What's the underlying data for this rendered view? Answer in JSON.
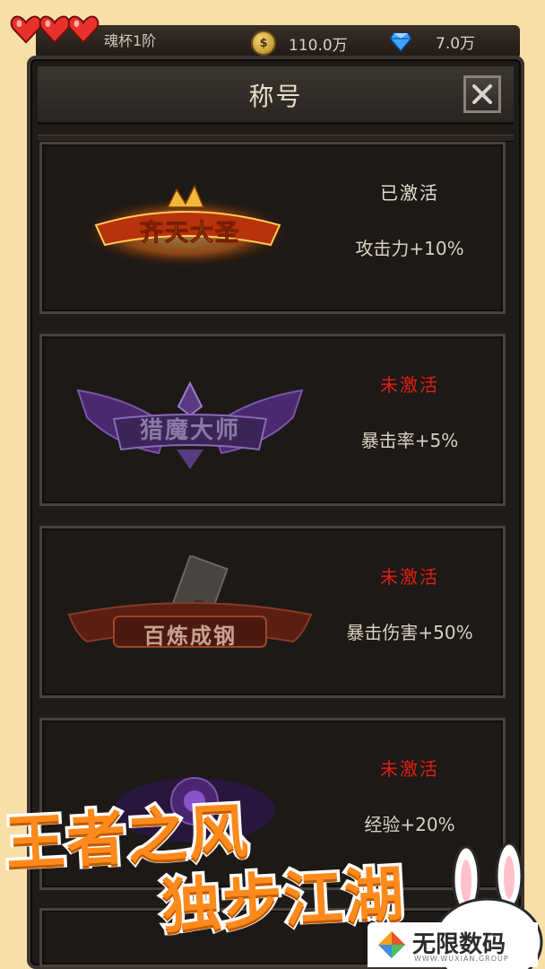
{
  "topbar": {
    "level_text": "魂杯1阶",
    "coins": {
      "icon": "coin-icon",
      "symbol": "$",
      "value": "110.0万"
    },
    "gems": {
      "icon": "diamond-icon",
      "value": "7.0万"
    }
  },
  "hearts": {
    "icon": "heart-icon",
    "count": 3,
    "color": "#e8312a"
  },
  "panel": {
    "title": "称号",
    "close_icon": "close-icon"
  },
  "titles": [
    {
      "badge_text": "齐天大圣",
      "status": "已激活",
      "active": true,
      "bonus": "攻击力+10%"
    },
    {
      "badge_text": "猎魔大师",
      "status": "未激活",
      "active": false,
      "bonus": "暴击率+5%"
    },
    {
      "badge_text": "百炼成钢",
      "status": "未激活",
      "active": false,
      "bonus": "暴击伤害+50%"
    },
    {
      "badge_text": "",
      "status": "未激活",
      "active": false,
      "bonus": "经验+20%"
    }
  ],
  "promo": {
    "line1": "王者之风",
    "line2": "独步江湖"
  },
  "watermark": {
    "name": "无限数码",
    "sub": "WWW.WUXIAN.GROUP"
  },
  "colors": {
    "active_status": "#e4dccd",
    "inactive_status": "#e11f13",
    "promo_orange": "#ff8a1c",
    "background": "#f8dfa7"
  }
}
